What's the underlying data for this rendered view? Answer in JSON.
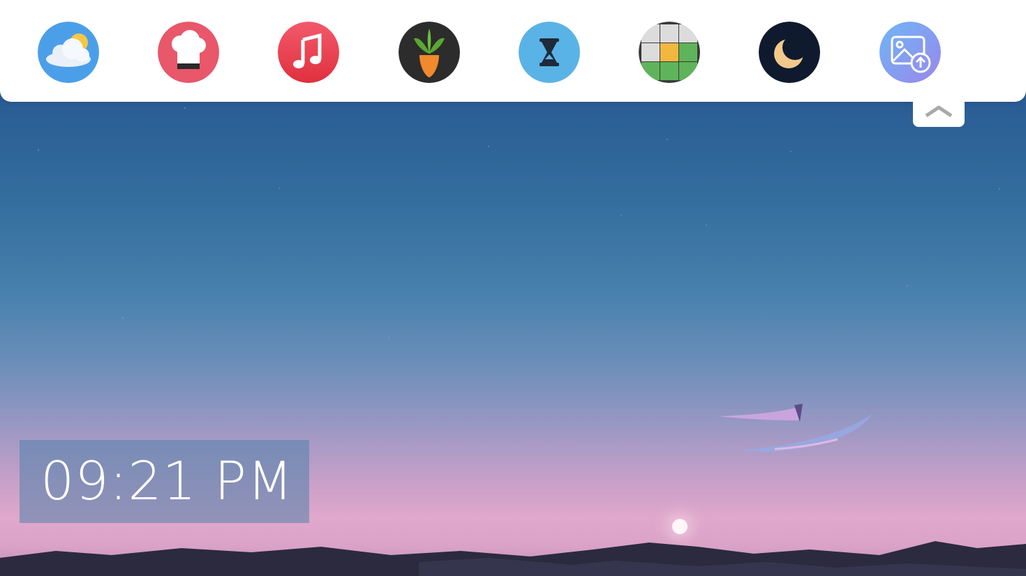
{
  "dock": {
    "apps": [
      {
        "name": "weather",
        "icon": "weather-icon",
        "color": "#4a9fe8"
      },
      {
        "name": "chef",
        "icon": "chef-hat-icon",
        "color": "#e8576a"
      },
      {
        "name": "music",
        "icon": "music-note-icon",
        "color": "#e8414f"
      },
      {
        "name": "carrot",
        "icon": "carrot-icon",
        "color": "#2d2d2d"
      },
      {
        "name": "timer",
        "icon": "hourglass-icon",
        "color": "#5ab3e6"
      },
      {
        "name": "word-grid",
        "icon": "letter-grid-icon",
        "color": "#5fb35a"
      },
      {
        "name": "sleep",
        "icon": "moon-icon",
        "color": "#0f1a2e"
      },
      {
        "name": "photo-upload",
        "icon": "image-upload-icon",
        "color": "#8a9ef0"
      }
    ],
    "collapse_icon": "chevron-up-icon"
  },
  "clock": {
    "time": "09:21 PM"
  }
}
